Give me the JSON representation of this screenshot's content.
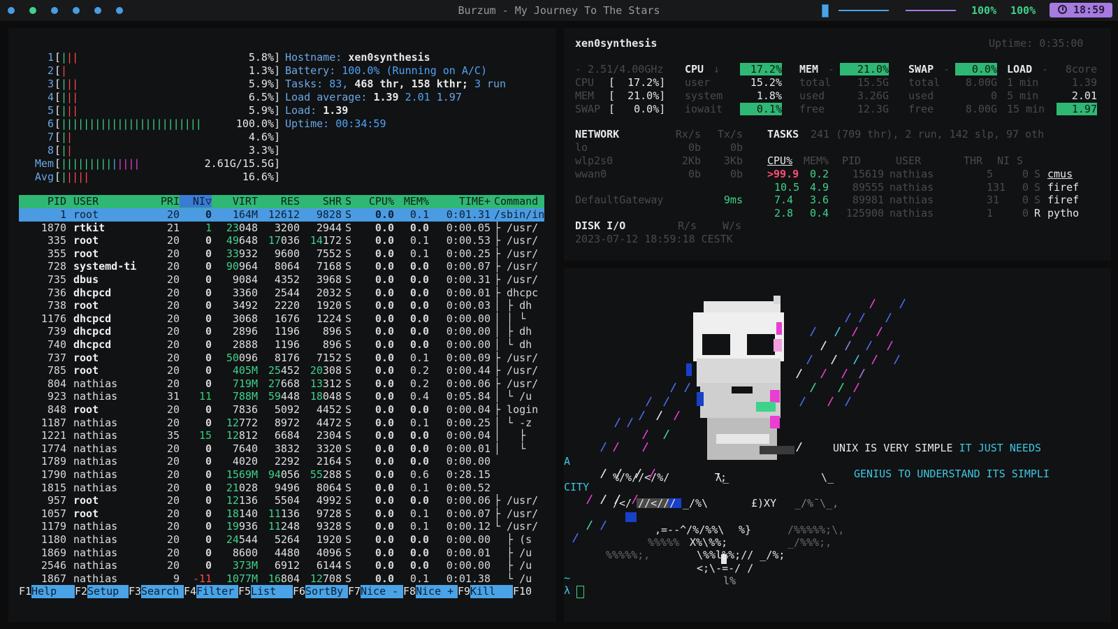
{
  "topbar": {
    "title": "Burzum - My Journey To The Stars",
    "volume": "100%",
    "brightness": "100%",
    "clock": "18:59",
    "workspace_colors": [
      "#4a9be0",
      "#3fd28a",
      "#4a9be0",
      "#4a9be0",
      "#4a9be0",
      "#4a9be0"
    ]
  },
  "htop": {
    "cpus": [
      {
        "label": "1",
        "bars": "|||",
        "pct": "5.8%"
      },
      {
        "label": "2",
        "bars": "|",
        "pct": "1.3%"
      },
      {
        "label": "3",
        "bars": "|||",
        "pct": "5.9%"
      },
      {
        "label": "4",
        "bars": "|||",
        "pct": "6.5%"
      },
      {
        "label": "5",
        "bars": "|||",
        "pct": "5.9%"
      },
      {
        "label": "6",
        "bars": "|||||||||||||||||||||||||100.0%",
        "pct": ""
      },
      {
        "label": "7",
        "bars": "||",
        "pct": "4.6%"
      },
      {
        "label": "8",
        "bars": "||",
        "pct": "3.3%"
      },
      {
        "label": "Mem",
        "bars": "||||||||||||||",
        "pct": "2.61G/15.5G"
      },
      {
        "label": "Avg",
        "bars": "|||||",
        "pct": "16.6%"
      }
    ],
    "info": {
      "hostname_label": "Hostname:",
      "hostname": "xen0synthesis",
      "battery_label": "Battery:",
      "battery": "100.0% (Running on A/C)",
      "tasks_label": "Tasks:",
      "tasks_count": "83",
      "tasks_thr": "468",
      "thr_label": "thr,",
      "tasks_kthr": "158",
      "kthr_label": "kthr;",
      "tasks_run": "3",
      "run_label": "run",
      "load_avg_label": "Load average:",
      "load1": "1.39",
      "load5": "2.01",
      "load15": "1.97",
      "load_label": "Load:",
      "load": "1.39",
      "uptime_label": "Uptime:",
      "uptime": "00:34:59"
    },
    "columns": [
      "PID",
      "USER",
      "PRI",
      "NI▽",
      "VIRT",
      "RES",
      "SHR",
      "S",
      "CPU%",
      "MEM%",
      "TIME+",
      "Command"
    ],
    "rows": [
      [
        "1",
        "root",
        "20",
        "0",
        "164M",
        "12612",
        "9828",
        "S",
        "0.0",
        "0.1",
        "0:01.31",
        "/sbin/in"
      ],
      [
        "1870",
        "rtkit",
        "21",
        "1",
        "23048",
        "3200",
        "2944",
        "S",
        "0.0",
        "0.0",
        "0:00.05",
        "├ /usr/"
      ],
      [
        "335",
        "root",
        "20",
        "0",
        "49648",
        "17036",
        "14172",
        "S",
        "0.0",
        "0.1",
        "0:00.53",
        "├ /usr/"
      ],
      [
        "355",
        "root",
        "20",
        "0",
        "33932",
        "9600",
        "7552",
        "S",
        "0.0",
        "0.1",
        "0:00.25",
        "├ /usr/"
      ],
      [
        "728",
        "systemd-ti",
        "20",
        "0",
        "90964",
        "8064",
        "7168",
        "S",
        "0.0",
        "0.0",
        "0:00.07",
        "├ /usr/"
      ],
      [
        "735",
        "dbus",
        "20",
        "0",
        "9084",
        "4352",
        "3968",
        "S",
        "0.0",
        "0.0",
        "0:00.31",
        "├ /usr/"
      ],
      [
        "736",
        "dhcpcd",
        "20",
        "0",
        "3360",
        "2544",
        "2032",
        "S",
        "0.0",
        "0.0",
        "0:00.01",
        "├ dhcpc"
      ],
      [
        "738",
        "root",
        "20",
        "0",
        "3492",
        "2220",
        "1920",
        "S",
        "0.0",
        "0.0",
        "0:00.03",
        "│ ├ dh"
      ],
      [
        "1176",
        "dhcpcd",
        "20",
        "0",
        "3068",
        "1676",
        "1224",
        "S",
        "0.0",
        "0.0",
        "0:00.00",
        "│ │ └"
      ],
      [
        "739",
        "dhcpcd",
        "20",
        "0",
        "2896",
        "1196",
        "896",
        "S",
        "0.0",
        "0.0",
        "0:00.00",
        "│ ├ dh"
      ],
      [
        "740",
        "dhcpcd",
        "20",
        "0",
        "2888",
        "1196",
        "896",
        "S",
        "0.0",
        "0.0",
        "0:00.00",
        "│ └ dh"
      ],
      [
        "737",
        "root",
        "20",
        "0",
        "50096",
        "8176",
        "7152",
        "S",
        "0.0",
        "0.1",
        "0:00.09",
        "├ /usr/"
      ],
      [
        "785",
        "root",
        "20",
        "0",
        "405M",
        "25452",
        "20308",
        "S",
        "0.0",
        "0.2",
        "0:00.44",
        "├ /usr/"
      ],
      [
        "804",
        "nathias",
        "20",
        "0",
        "719M",
        "27668",
        "13312",
        "S",
        "0.0",
        "0.2",
        "0:00.06",
        "├ /usr/"
      ],
      [
        "923",
        "nathias",
        "31",
        "11",
        "788M",
        "59448",
        "18048",
        "S",
        "0.0",
        "0.4",
        "0:05.84",
        "│ └ /u"
      ],
      [
        "848",
        "root",
        "20",
        "0",
        "7836",
        "5092",
        "4452",
        "S",
        "0.0",
        "0.0",
        "0:00.04",
        "├ login"
      ],
      [
        "1187",
        "nathias",
        "20",
        "0",
        "12772",
        "8972",
        "4472",
        "S",
        "0.0",
        "0.1",
        "0:00.25",
        "│ └ -z"
      ],
      [
        "1221",
        "nathias",
        "35",
        "15",
        "12812",
        "6684",
        "2304",
        "S",
        "0.0",
        "0.0",
        "0:00.04",
        "│   ├"
      ],
      [
        "1774",
        "nathias",
        "20",
        "0",
        "7640",
        "3832",
        "3320",
        "S",
        "0.0",
        "0.0",
        "0:00.01",
        "│   └"
      ],
      [
        "1789",
        "nathias",
        "20",
        "0",
        "4020",
        "2292",
        "2164",
        "S",
        "0.0",
        "0.0",
        "0:00.00",
        ""
      ],
      [
        "1790",
        "nathias",
        "20",
        "0",
        "1569M",
        "94056",
        "55288",
        "S",
        "0.0",
        "0.6",
        "0:28.15",
        ""
      ],
      [
        "1815",
        "nathias",
        "20",
        "0",
        "21028",
        "9496",
        "8064",
        "S",
        "0.0",
        "0.1",
        "0:00.52",
        ""
      ],
      [
        "957",
        "root",
        "20",
        "0",
        "12136",
        "5504",
        "4992",
        "S",
        "0.0",
        "0.0",
        "0:00.06",
        "├ /usr/"
      ],
      [
        "1057",
        "root",
        "20",
        "0",
        "18140",
        "11136",
        "9728",
        "S",
        "0.0",
        "0.1",
        "0:00.07",
        "├ /usr/"
      ],
      [
        "1179",
        "nathias",
        "20",
        "0",
        "19936",
        "11248",
        "9328",
        "S",
        "0.0",
        "0.1",
        "0:00.12",
        "└ /usr/"
      ],
      [
        "1180",
        "nathias",
        "20",
        "0",
        "24544",
        "5264",
        "1920",
        "S",
        "0.0",
        "0.0",
        "0:00.00",
        "  ├ (s"
      ],
      [
        "1869",
        "nathias",
        "20",
        "0",
        "8600",
        "4480",
        "4096",
        "S",
        "0.0",
        "0.0",
        "0:00.01",
        "  ├ /u"
      ],
      [
        "2546",
        "nathias",
        "20",
        "0",
        "373M",
        "6912",
        "6144",
        "S",
        "0.0",
        "0.0",
        "0:00.00",
        "  ├ /u"
      ],
      [
        "1867",
        "nathias",
        "9",
        "-11",
        "1077M",
        "16804",
        "12708",
        "S",
        "0.0",
        "0.1",
        "0:01.38",
        "  └ /u"
      ]
    ],
    "fkeys": [
      {
        "key": "F1",
        "label": "Help"
      },
      {
        "key": "F2",
        "label": "Setup"
      },
      {
        "key": "F3",
        "label": "Search"
      },
      {
        "key": "F4",
        "label": "Filter"
      },
      {
        "key": "F5",
        "label": "List"
      },
      {
        "key": "F6",
        "label": "SortBy"
      },
      {
        "key": "F7",
        "label": "Nice -"
      },
      {
        "key": "F8",
        "label": "Nice +"
      },
      {
        "key": "F9",
        "label": "Kill"
      },
      {
        "key": "F10",
        "label": ""
      }
    ]
  },
  "glances": {
    "host": "xen0synthesis",
    "uptime": "Uptime: 0:35:00",
    "cpu_freq": "- 2.51/4.00GHz",
    "cpu": {
      "title": "CPU",
      "arrow": "↓",
      "total": "17.2%",
      "user": "15.2%",
      "system": "1.8%",
      "iowait": "0.1%"
    },
    "mem": {
      "title": "MEM",
      "dash": "-",
      "pct": "21.0%",
      "total": "15.5G",
      "used": "3.26G",
      "free": "12.3G"
    },
    "swap": {
      "title": "SWAP",
      "dash": "-",
      "pct": "0.0%",
      "total": "8.00G",
      "used": "0",
      "free": "8.00G"
    },
    "load": {
      "title": "LOAD",
      "dash": "-",
      "cores": "8core",
      "m1": "1.39",
      "m5": "2.01",
      "m15": "1.97"
    },
    "quicklook": [
      {
        "name": "CPU",
        "val": "[  17.2%]"
      },
      {
        "name": "MEM",
        "val": "[  21.0%]"
      },
      {
        "name": "SWAP",
        "val": "[   0.0%]"
      }
    ],
    "labels": {
      "user": "user",
      "system": "system",
      "iowait": "iowait",
      "total": "total",
      "used": "used",
      "free": "free",
      "min1": "1 min",
      "min5": "5 min",
      "min15": "15 min"
    },
    "network": {
      "title": "NETWORK",
      "rx": "Rx/s",
      "tx": "Tx/s",
      "ifaces": [
        {
          "name": "lo",
          "rx": "0b",
          "tx": "0b"
        },
        {
          "name": "wlp2s0",
          "rx": "2Kb",
          "tx": "3Kb"
        },
        {
          "name": "wwan0",
          "rx": "0b",
          "tx": "0b"
        }
      ],
      "gateway": "DefaultGateway",
      "gateway_val": "9ms"
    },
    "tasks": {
      "title": "TASKS",
      "summary": "241 (709 thr), 2 run, 142 slp, 97 oth",
      "headers": [
        "CPU%",
        "MEM%",
        "PID",
        "USER",
        "THR",
        "NI",
        "S"
      ],
      "rows": [
        {
          "cpu": ">99.9",
          "mem": "0.2",
          "pid": "15619",
          "user": "nathias",
          "thr": "5",
          "ni": "0",
          "s": "S",
          "cmd": "cmus"
        },
        {
          "cpu": "10.5",
          "mem": "4.9",
          "pid": "89555",
          "user": "nathias",
          "thr": "131",
          "ni": "0",
          "s": "S",
          "cmd": "firef"
        },
        {
          "cpu": "7.4",
          "mem": "3.6",
          "pid": "89981",
          "user": "nathias",
          "thr": "31",
          "ni": "0",
          "s": "S",
          "cmd": "firef"
        },
        {
          "cpu": "2.8",
          "mem": "0.4",
          "pid": "125900",
          "user": "nathias",
          "thr": "1",
          "ni": "0",
          "s": "R",
          "cmd": "pytho"
        }
      ]
    },
    "disk": {
      "title": "DISK I/O",
      "r": "R/s",
      "w": "W/s",
      "timestamp": "2023-07-12 18:59:18 CESTK"
    }
  },
  "terminal": {
    "quote_1a": "UNIX IS VERY SIMPLE ",
    "quote_1b": "IT JUST NEEDS",
    "quote_1c": "A",
    "quote_2": "GENIUS TO UNDERSTAND ITS SIMPLI",
    "quote_2b": "CITY",
    "cwd": "~",
    "prompt": "λ"
  }
}
